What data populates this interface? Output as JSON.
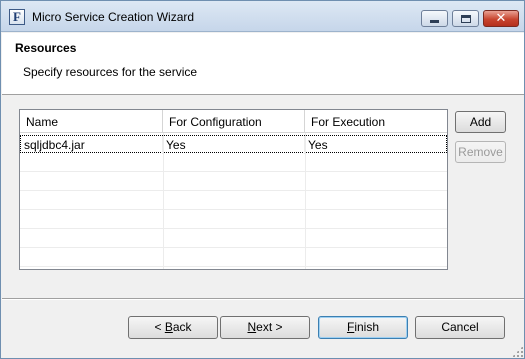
{
  "window": {
    "title": "Micro Service Creation Wizard",
    "icon_letter": "F",
    "controls": {
      "minimize": "minimize-icon",
      "maximize": "maximize-icon",
      "close": "close-icon"
    }
  },
  "header": {
    "title": "Resources",
    "subtitle": "Specify resources  for the service"
  },
  "table": {
    "columns": [
      "Name",
      "For Configuration",
      "For Execution"
    ],
    "rows": [
      {
        "name": "sqljdbc4.jar",
        "for_configuration": "Yes",
        "for_execution": "Yes"
      }
    ]
  },
  "side_buttons": {
    "add": "Add",
    "remove": "Remove"
  },
  "footer": {
    "back": {
      "prefix": "< ",
      "mnemonic": "B",
      "rest": "ack"
    },
    "next": {
      "mnemonic": "N",
      "rest": "ext >"
    },
    "finish": {
      "mnemonic": "F",
      "rest": "inish"
    },
    "cancel": "Cancel"
  }
}
